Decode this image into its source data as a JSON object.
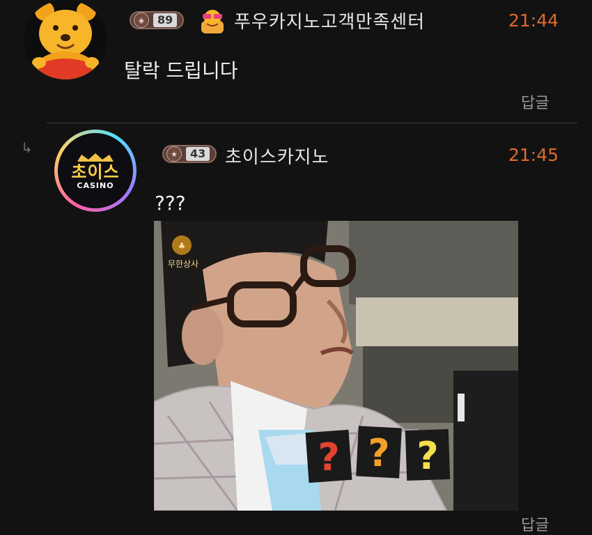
{
  "comments": [
    {
      "level": "89",
      "username": "푸우카지노고객만족센터",
      "time": "21:44",
      "message": "탈락 드립니다",
      "reply_label": "답글"
    },
    {
      "level": "43",
      "username": "초이스카지노",
      "time": "21:45",
      "message": "???",
      "reply_label": "답글",
      "avatar_text": "초이스",
      "avatar_subtext": "CASINO",
      "image": {
        "logo_text": "무한상사",
        "overlay_text": [
          "?",
          "?",
          "?"
        ]
      }
    }
  ],
  "colors": {
    "background": "#121212",
    "time": "#e06a2c",
    "username": "#e6e6e6",
    "reply": "#9a9a9a"
  }
}
